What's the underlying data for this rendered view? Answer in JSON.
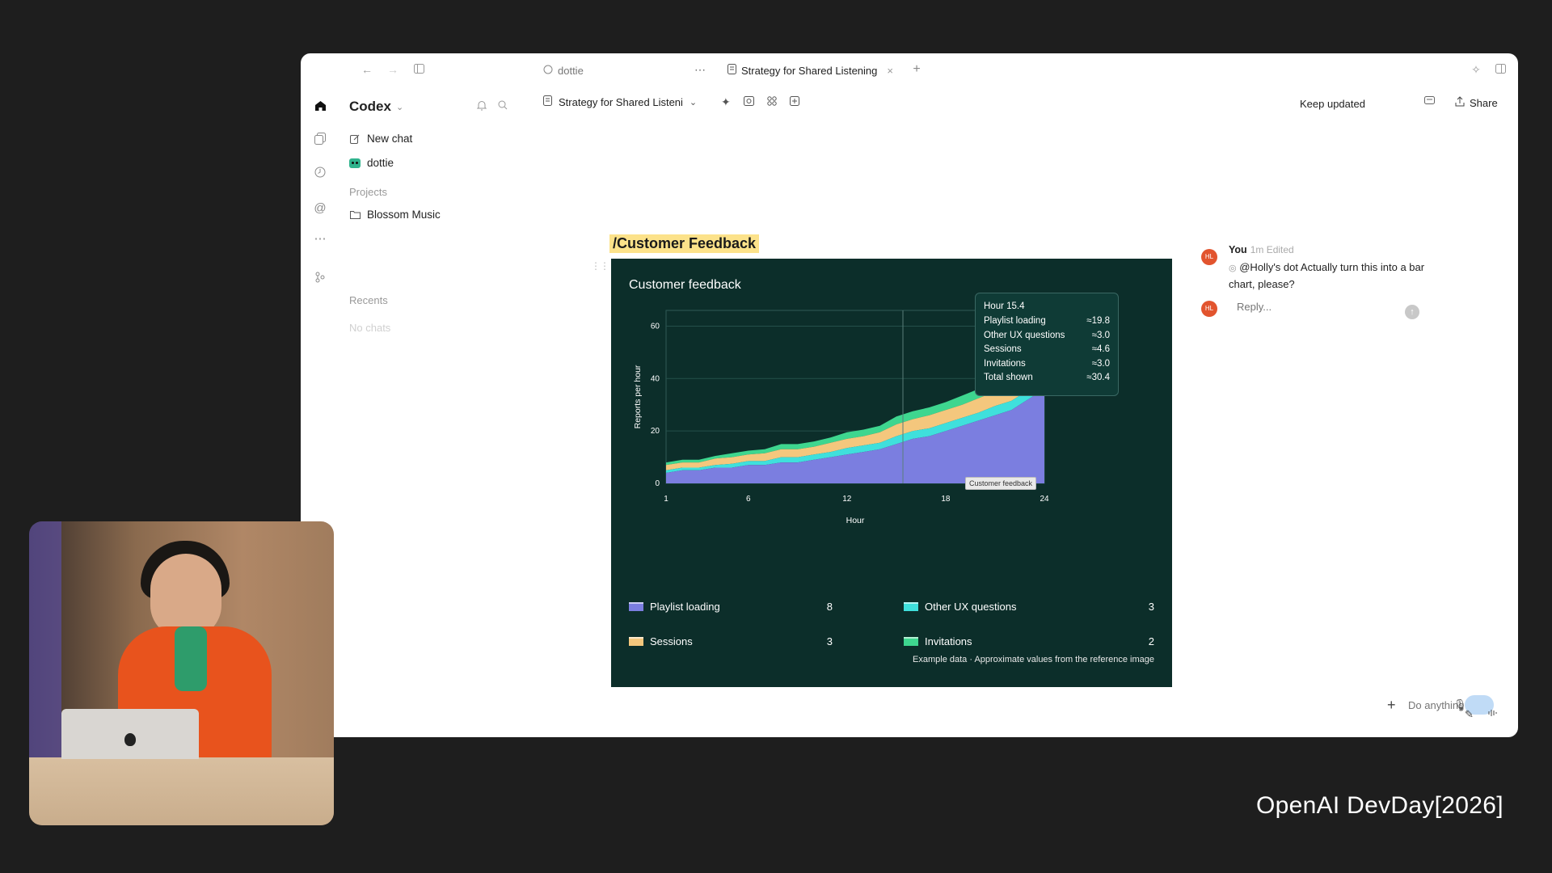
{
  "window": {
    "tabs": [
      {
        "label": "dottie",
        "icon": "chat-bubble-icon",
        "active": false
      },
      {
        "label": "Strategy for Shared Listening",
        "icon": "doc-icon",
        "active": true
      }
    ]
  },
  "sidebar": {
    "workspace": "Codex",
    "items": [
      {
        "label": "New chat",
        "icon": "compose-icon"
      },
      {
        "label": "dottie",
        "icon": "dottie-avatar-icon"
      }
    ],
    "projects_heading": "Projects",
    "projects": [
      {
        "label": "Blossom Music",
        "icon": "folder-icon"
      }
    ],
    "recents_heading": "Recents",
    "recents_empty": "No chats"
  },
  "doc_toolbar": {
    "title": "Strategy for Shared Listeni",
    "keep_updated": "Keep updated",
    "share_label": "Share"
  },
  "page": {
    "title": "/Customer Feedback"
  },
  "chart_data": {
    "type": "area",
    "stacked": true,
    "title": "Customer feedback",
    "xlabel": "Hour",
    "ylabel": "Reports per hour",
    "xlim": [
      1,
      24
    ],
    "ylim": [
      0,
      66
    ],
    "x_ticks": [
      1,
      6,
      12,
      18,
      24
    ],
    "y_ticks": [
      0,
      20,
      40,
      60
    ],
    "grid": true,
    "x": [
      1,
      2,
      3,
      4,
      5,
      6,
      7,
      8,
      9,
      10,
      11,
      12,
      13,
      14,
      15,
      16,
      17,
      18,
      19,
      20,
      21,
      22,
      23,
      24
    ],
    "series": [
      {
        "name": "Playlist loading",
        "color": "#7b7ee0",
        "values": [
          4,
          5,
          5,
          6,
          6,
          7,
          7,
          8,
          8,
          9,
          10,
          11,
          12,
          13,
          15,
          17,
          18,
          20,
          22,
          24,
          26,
          28,
          32,
          36
        ]
      },
      {
        "name": "Other UX questions",
        "color": "#3fe0dc",
        "values": [
          1,
          1,
          1,
          1,
          1.5,
          1.5,
          1.5,
          2,
          2,
          2,
          2,
          2.5,
          2.5,
          2.5,
          3,
          3,
          3,
          3,
          3,
          3,
          3.5,
          3.5,
          3.5,
          3.5
        ]
      },
      {
        "name": "Sessions",
        "color": "#f4c77d",
        "values": [
          2,
          2,
          2,
          2.5,
          2.5,
          2.5,
          3,
          3,
          3,
          3,
          3.5,
          3.5,
          3.5,
          4,
          4.5,
          4.5,
          5,
          5,
          5,
          5.5,
          5.5,
          6,
          6,
          6
        ]
      },
      {
        "name": "Invitations",
        "color": "#3ed68f",
        "values": [
          1,
          1,
          1,
          1,
          1.5,
          1.5,
          1.5,
          2,
          2,
          2,
          2,
          2.5,
          2.5,
          2.5,
          3,
          3,
          3,
          3,
          3.5,
          3.5,
          3.5,
          4,
          4,
          4
        ]
      }
    ],
    "legend": [
      {
        "name": "Playlist loading",
        "count": "8",
        "color": "#7b7ee0"
      },
      {
        "name": "Other UX questions",
        "count": "3",
        "color": "#3fe0dc"
      },
      {
        "name": "Sessions",
        "count": "3",
        "color": "#f4c77d"
      },
      {
        "name": "Invitations",
        "count": "2",
        "color": "#3ed68f"
      }
    ],
    "tooltip": {
      "title": "Hour 15.4",
      "rows": [
        {
          "label": "Playlist loading",
          "value": "≈19.8"
        },
        {
          "label": "Other UX questions",
          "value": "≈3.0"
        },
        {
          "label": "Sessions",
          "value": "≈4.6"
        },
        {
          "label": "Invitations",
          "value": "≈3.0"
        },
        {
          "label": "Total shown",
          "value": "≈30.4"
        }
      ],
      "hover_x": 15.4,
      "hover_label": "Customer feedback"
    },
    "footnote": "Example data · Approximate values from the reference image"
  },
  "comments": {
    "author": "You",
    "meta": "1m Edited",
    "avatar_initials": "HL",
    "body_mention": "@Holly's dot",
    "body_text": " Actually turn this into a bar chart, please?",
    "reply_placeholder": "Reply..."
  },
  "composer": {
    "placeholder": "Do anything"
  },
  "overlay": {
    "event_brand": "OpenAI DevDay[2026]"
  }
}
